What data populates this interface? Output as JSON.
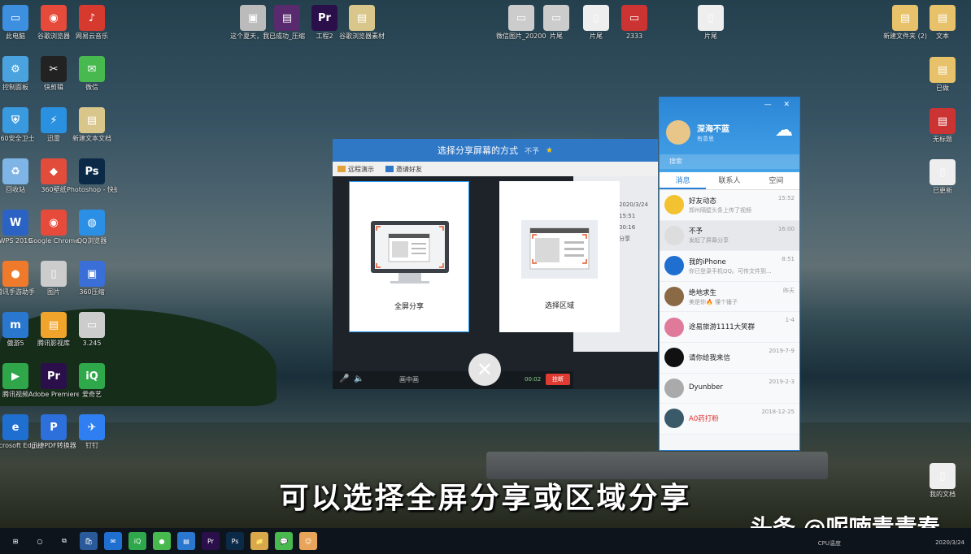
{
  "desktop_left": [
    {
      "label": "此电脑",
      "c": "#3d8fe0",
      "g": "▭"
    },
    {
      "label": "谷歌浏览器",
      "c": "#e64a3a",
      "g": "◉"
    },
    {
      "label": "网易云音乐",
      "c": "#d63a2f",
      "g": "♪"
    },
    {
      "label": "控制面板",
      "c": "#4aa3df",
      "g": "⚙"
    },
    {
      "label": "快剪辑",
      "c": "#222",
      "g": "✂"
    },
    {
      "label": "微信",
      "c": "#48b94f",
      "g": "✉"
    },
    {
      "label": "360安全卫士",
      "c": "#3a9ae0",
      "g": "⛨"
    },
    {
      "label": "迅雷",
      "c": "#2a90e0",
      "g": "⚡"
    },
    {
      "label": "新建文本文档",
      "c": "#d8c68a",
      "g": "▤"
    },
    {
      "label": "回收站",
      "c": "#7fb5e6",
      "g": "♻"
    },
    {
      "label": "360壁纸",
      "c": "#e24c3b",
      "g": "◆"
    },
    {
      "label": "Photoshop - 快捷方式",
      "c": "#0b2a48",
      "g": "Ps"
    },
    {
      "label": "WPS 2019",
      "c": "#2b63c4",
      "g": "W"
    },
    {
      "label": "Google Chrome",
      "c": "#e64a3a",
      "g": "◉"
    },
    {
      "label": "QQ浏览器",
      "c": "#2a8fe5",
      "g": "◍"
    },
    {
      "label": "腾讯手游助手",
      "c": "#f07a2b",
      "g": "●"
    },
    {
      "label": "图片",
      "c": "#cccccc",
      "g": "▯"
    },
    {
      "label": "360压缩",
      "c": "#3a6fd8",
      "g": "▣"
    },
    {
      "label": "傲游5",
      "c": "#2a77d0",
      "g": "m"
    },
    {
      "label": "腾讯影视库",
      "c": "#f0a42b",
      "g": "▤"
    },
    {
      "label": "3.245",
      "c": "#cccccc",
      "g": "▭"
    },
    {
      "label": "腾讯视频",
      "c": "#2fa64a",
      "g": "▶"
    },
    {
      "label": "Adobe Premiere ...",
      "c": "#2a0f4a",
      "g": "Pr"
    },
    {
      "label": "爱奇艺",
      "c": "#2ea84b",
      "g": "iQ"
    },
    {
      "label": "Microsoft Edge",
      "c": "#1f6fd1",
      "g": "e"
    },
    {
      "label": "迅捷PDF转换器",
      "c": "#2d6fdb",
      "g": "P"
    },
    {
      "label": "钉钉",
      "c": "#2f7ef2",
      "g": "✈"
    }
  ],
  "desktop_top": [
    {
      "label": "这个夏天，我...",
      "c": "#bbbbbb",
      "g": "▣"
    },
    {
      "label": "已成功_压缩",
      "c": "#5a2a6e",
      "g": "▤"
    },
    {
      "label": "工程2",
      "c": "#2a0f4a",
      "g": "Pr"
    },
    {
      "label": "谷歌浏览器素材",
      "c": "#d8c68a",
      "g": "▤"
    },
    {
      "label": "微信图片_20200...",
      "c": "#cccccc",
      "g": "▭"
    },
    {
      "label": "片尾",
      "c": "#cccccc",
      "g": "▭"
    },
    {
      "label": "片尾",
      "c": "#eeeeee",
      "g": "▯"
    },
    {
      "label": "2333",
      "c": "#cc3333",
      "g": "▭"
    },
    {
      "label": "片尾",
      "c": "#eeeeee",
      "g": "▯"
    }
  ],
  "desktop_right": [
    {
      "label": "新建文件夹 (2)",
      "c": "#e8c26a",
      "g": "▤"
    },
    {
      "label": "文本",
      "c": "#e8c26a",
      "g": "▤"
    },
    {
      "label": "已做",
      "c": "#e8c26a",
      "g": "▤"
    },
    {
      "label": "无标题",
      "c": "#cc3333",
      "g": "▤"
    },
    {
      "label": "已更新",
      "c": "#eeeeee",
      "g": "▯"
    },
    {
      "label": "我的文档",
      "c": "#eeeeee",
      "g": "▯"
    }
  ],
  "share_window": {
    "title": "选择分享屏幕的方式",
    "user": "不予",
    "tool_remote": "远程演示",
    "tool_invite": "邀请好友",
    "full_label": "全屏分享",
    "area_label": "选择区域",
    "hangup": "挂断",
    "timer": "00:02",
    "mic_label": "画中画",
    "side_times": [
      "2020/3/24 15:51",
      "00:16",
      "分享"
    ]
  },
  "qq": {
    "nickname": "深海不蓝",
    "status": "有意思",
    "search_placeholder": "搜索",
    "tabs": [
      "消息",
      "联系人",
      "空间"
    ],
    "chats": [
      {
        "name": "好友动态",
        "preview": "郑州隔壁头条上传了视频",
        "time": "15:52",
        "c": "#f2c230",
        "red": false
      },
      {
        "name": "不予",
        "preview": "发起了屏幕分享",
        "time": "16:00",
        "c": "#dddddd",
        "red": false
      },
      {
        "name": "我的iPhone",
        "preview": "你已登录手机QQ。可传文件到...",
        "time": "8:51",
        "c": "#1f6fd1",
        "red": false
      },
      {
        "name": "绝地求生",
        "preview": "美是你🔥 懂个锤子",
        "time": "昨天",
        "c": "#8a6a44",
        "red": false
      },
      {
        "name": "途易旅游1111大笑群",
        "preview": "",
        "time": "1-4",
        "c": "#e07a9a",
        "red": false
      },
      {
        "name": "请你给我来信",
        "preview": "",
        "time": "2019-7-9",
        "c": "#111111",
        "red": false
      },
      {
        "name": "Dyunbber",
        "preview": "",
        "time": "2019-2-3",
        "c": "#aaaaaa",
        "red": false
      },
      {
        "name": "A0药打粉",
        "preview": "",
        "time": "2018-12-25",
        "c": "#3a5a6a",
        "red": true
      }
    ]
  },
  "taskbar": {
    "items": [
      "⊞",
      "○",
      "⧉",
      "🛍",
      "✉",
      "iQ",
      "●",
      "▤",
      "Pr",
      "Ps",
      "📁",
      "💬",
      "☺"
    ],
    "time": "2020/3/24",
    "cpu": "CPU温度"
  },
  "overlay": {
    "subtitle": "可以选择全屏分享或区域分享",
    "watermark": "头条 @呢喃青青春"
  }
}
